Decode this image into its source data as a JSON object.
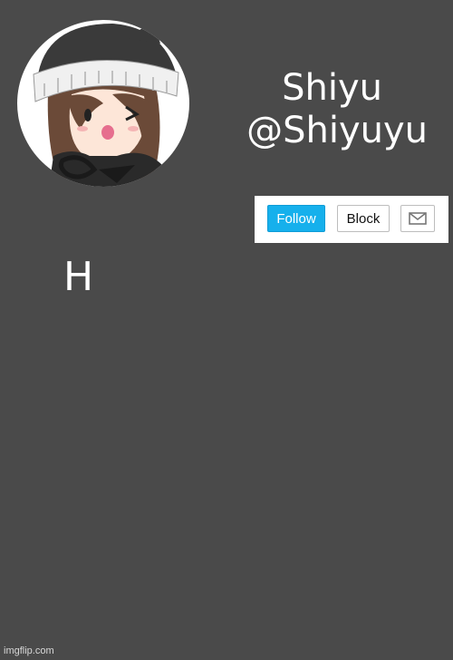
{
  "profile": {
    "display_name": "Shiyu",
    "handle": "@Shiyuyu"
  },
  "actions": {
    "follow_label": "Follow",
    "block_label": "Block",
    "message_icon": "envelope-icon"
  },
  "post": {
    "text": "H"
  },
  "watermark": {
    "text": "imgflip.com"
  },
  "colors": {
    "background": "#4a4a4a",
    "follow_button": "#16b0ec",
    "text": "#ffffff"
  }
}
